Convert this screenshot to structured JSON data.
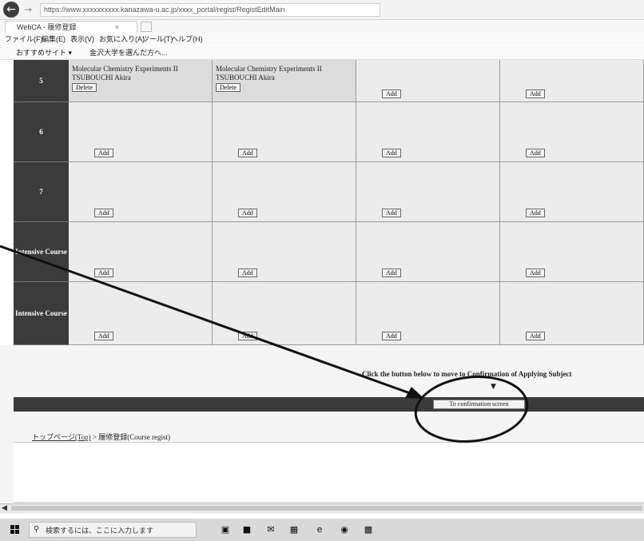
{
  "browser": {
    "back_icon": "back-arrow-icon",
    "url": "https://www.xxxxxxxxxx.kanazawa-u.ac.jp/xxxx_portal/regist/RegistEditMain",
    "tab_title": "WebCA - 履修登録",
    "tab_close": "×",
    "menu": [
      "ファイル(F)",
      "編集(E)",
      "表示(V)",
      "お気に入り(A)",
      "ツール(T)",
      "ヘルプ(H)"
    ],
    "favorites": [
      "おすすめサイト ▾",
      "金沢大学を選んだ方へ..."
    ]
  },
  "timetable": {
    "rows": [
      {
        "label": "5",
        "cells": [
          {
            "title": "Molecular Chemistry Experiments II",
            "teacher": "TSUBOUCHI Akira",
            "button": "Delete"
          },
          {
            "title": "Molecular Chemistry Experiments II",
            "teacher": "TSUBOUCHI Akira",
            "button": "Delete"
          },
          {
            "button": "Add"
          },
          {
            "button": "Add"
          }
        ]
      },
      {
        "label": "6",
        "cells": [
          {
            "button": "Add"
          },
          {
            "button": "Add"
          },
          {
            "button": "Add"
          },
          {
            "button": "Add"
          }
        ]
      },
      {
        "label": "7",
        "cells": [
          {
            "button": "Add"
          },
          {
            "button": "Add"
          },
          {
            "button": "Add"
          },
          {
            "button": "Add"
          }
        ]
      },
      {
        "label": "Intensive Course",
        "cells": [
          {
            "button": "Add"
          },
          {
            "button": "Add"
          },
          {
            "button": "Add"
          },
          {
            "button": "Add"
          }
        ]
      },
      {
        "label": "Intensive Course",
        "cells": [
          {
            "button": "Add"
          },
          {
            "button": "Add"
          },
          {
            "button": "Add"
          },
          {
            "button": "Add"
          }
        ]
      }
    ]
  },
  "footer": {
    "instruction": "Click the button below to move to Confirmation of Applying Subject",
    "down_marker": "▼",
    "confirm_button": "To confirmation screen",
    "breadcrumb_link": "トップページ(Top)",
    "breadcrumb_sep": " > ",
    "breadcrumb_current": "履修登録(Course regist)"
  },
  "taskbar": {
    "search_placeholder": "検索するには、ここに入力します",
    "icons": [
      "task-view-icon",
      "file-explorer-icon",
      "mail-icon",
      "store-icon",
      "edge-icon",
      "media-icon",
      "app-icon"
    ]
  },
  "annotation": {
    "arrow_color": "#111111",
    "circle_color": "#111111"
  }
}
